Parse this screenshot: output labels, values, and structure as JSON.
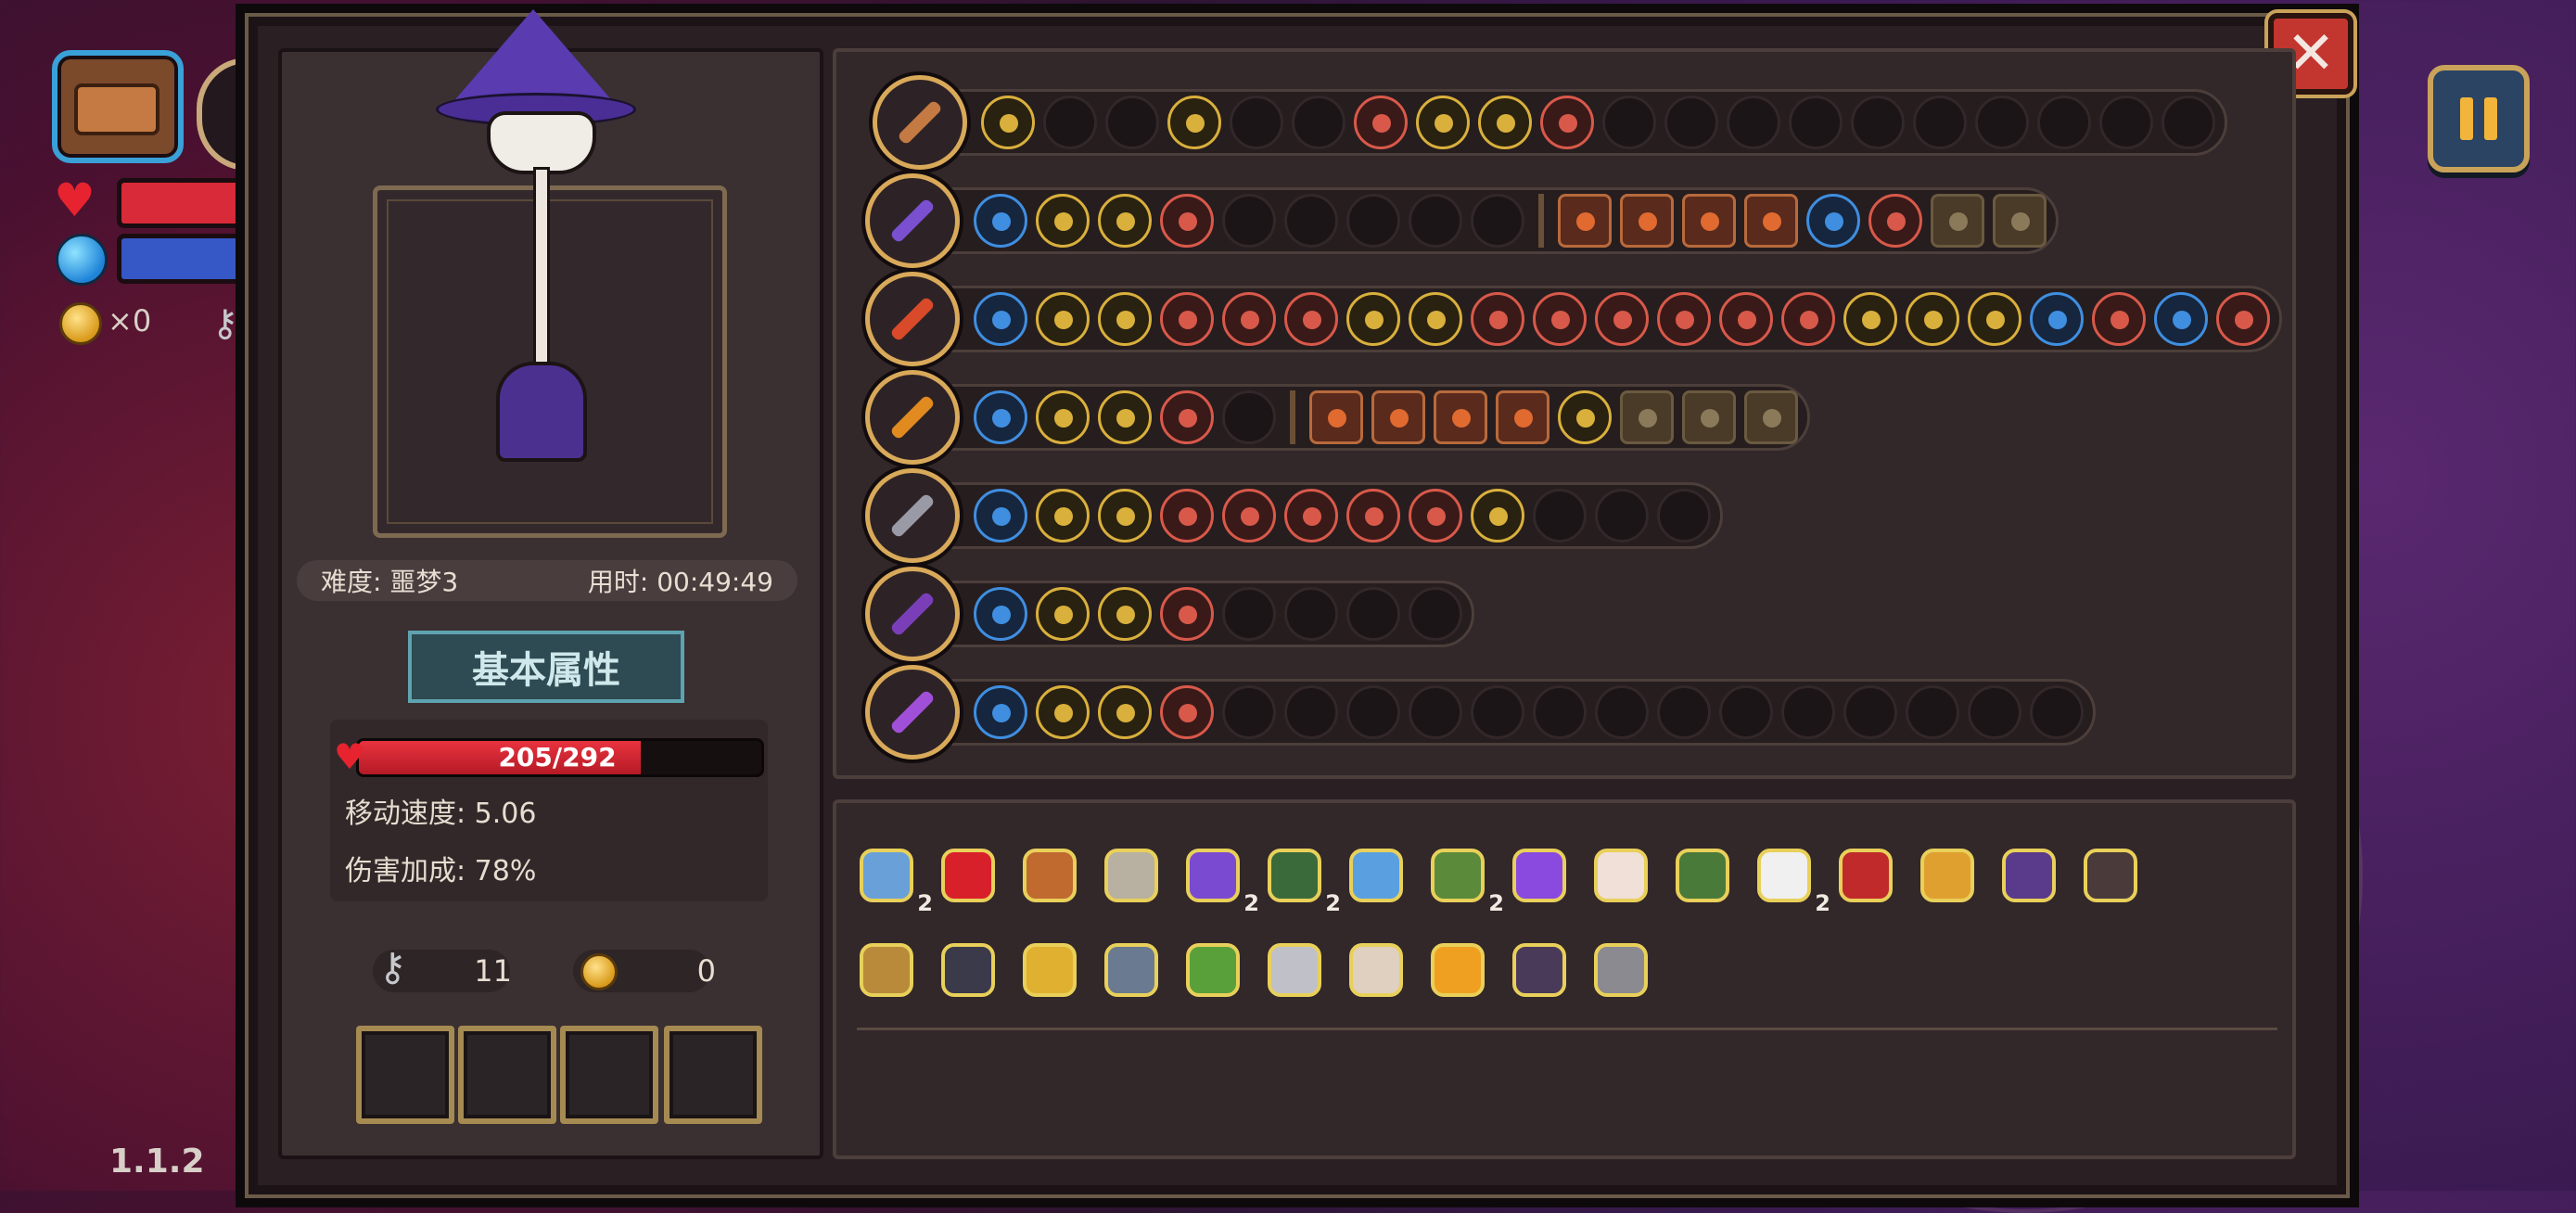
{
  "hud": {
    "coin_count": "×0",
    "version": "1.1.2"
  },
  "left_panel": {
    "difficulty": "难度: 噩梦3",
    "time": "用时: 00:49:49",
    "section_title": "基本属性",
    "hp_text": "205/292",
    "hp_fraction": 0.7,
    "move_speed": "移动速度: 5.06",
    "damage_bonus": "伤害加成: 78%",
    "keys": "11",
    "coins": "0"
  },
  "weapon_rows": [
    {
      "slots": [
        "g",
        "e",
        "e",
        "g",
        "e",
        "e",
        "r",
        "g",
        "g",
        "r",
        "e",
        "e",
        "e",
        "e",
        "e",
        "e",
        "e",
        "e",
        "e",
        "e"
      ]
    },
    {
      "slots": [
        "b",
        "g",
        "g",
        "r",
        "e",
        "e",
        "e",
        "e",
        "e"
      ],
      "extra": [
        "sq",
        "sq",
        "sq",
        "sq",
        "b",
        "r",
        "sqd",
        "sqd"
      ]
    },
    {
      "slots": [
        "b",
        "g",
        "g",
        "r",
        "r",
        "r",
        "g",
        "g",
        "r",
        "r",
        "r",
        "r",
        "r",
        "r",
        "g",
        "g",
        "g",
        "b",
        "r",
        "b",
        "r"
      ]
    },
    {
      "slots": [
        "b",
        "g",
        "g",
        "r",
        "e"
      ],
      "extra": [
        "sq",
        "sq",
        "sq",
        "sq",
        "g",
        "sqd",
        "sqd",
        "sqd"
      ]
    },
    {
      "slots": [
        "b",
        "g",
        "g",
        "r",
        "r",
        "r",
        "r",
        "r",
        "g",
        "e",
        "e",
        "e"
      ]
    },
    {
      "slots": [
        "b",
        "g",
        "g",
        "r",
        "e",
        "e",
        "e",
        "e"
      ]
    },
    {
      "slots": [
        "b",
        "g",
        "g",
        "r",
        "e",
        "e",
        "e",
        "e",
        "e",
        "e",
        "e",
        "e",
        "e",
        "e",
        "e",
        "e",
        "e",
        "e"
      ]
    }
  ],
  "items_row1": [
    {
      "icon": "ghost-shield-icon",
      "count": "2"
    },
    {
      "icon": "red-orb-icon",
      "count": ""
    },
    {
      "icon": "bracer-icon",
      "count": ""
    },
    {
      "icon": "feather-spear-icon",
      "count": ""
    },
    {
      "icon": "wizard-hat-icon",
      "count": "2"
    },
    {
      "icon": "green-belt-icon",
      "count": "2"
    },
    {
      "icon": "blue-ring-icon",
      "count": ""
    },
    {
      "icon": "green-boot-icon",
      "count": "2"
    },
    {
      "icon": "purple-boot-icon",
      "count": ""
    },
    {
      "icon": "horn-icon",
      "count": ""
    },
    {
      "icon": "green-leaf-icon",
      "count": ""
    },
    {
      "icon": "fang-necklace-icon",
      "count": "2"
    },
    {
      "icon": "eye-amulet-icon",
      "count": ""
    },
    {
      "icon": "scroll-icon",
      "count": ""
    },
    {
      "icon": "purple-cape-icon",
      "count": ""
    },
    {
      "icon": "dark-shield-icon",
      "count": ""
    }
  ],
  "items_row2": [
    {
      "icon": "crate-icon",
      "count": ""
    },
    {
      "icon": "dark-gem-icon",
      "count": ""
    },
    {
      "icon": "golden-crown-icon",
      "count": ""
    },
    {
      "icon": "stone-shard-icon",
      "count": ""
    },
    {
      "icon": "green-potion-icon",
      "count": ""
    },
    {
      "icon": "swirl-icon",
      "count": ""
    },
    {
      "icon": "glasses-icon",
      "count": ""
    },
    {
      "icon": "candy-corn-icon",
      "count": ""
    },
    {
      "icon": "chest-armor-icon",
      "count": ""
    },
    {
      "icon": "sword-icon",
      "count": ""
    }
  ],
  "colors": {
    "gold": "#d9b03c",
    "blue": "#3f8ee0",
    "red": "#d8594a",
    "hp": "#e8333f"
  }
}
